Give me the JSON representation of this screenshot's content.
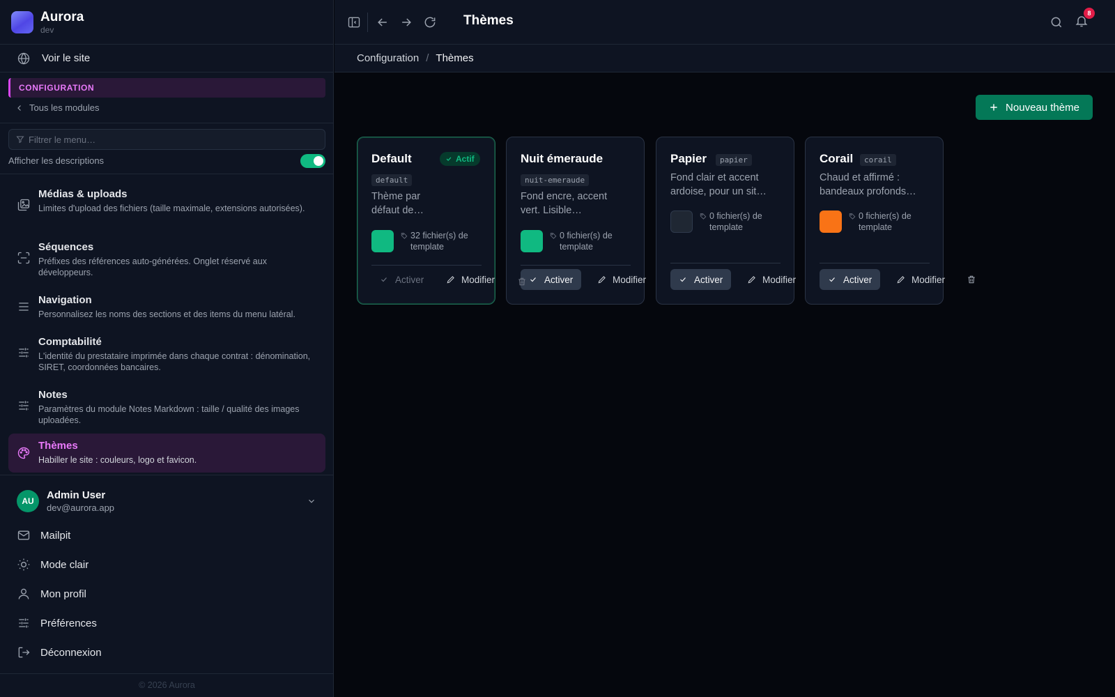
{
  "app": {
    "name": "Aurora",
    "env": "dev"
  },
  "sidebar": {
    "view_site": "Voir le site",
    "section_label": "CONFIGURATION",
    "back_link": "Tous les modules",
    "filter_placeholder": "Filtrer le menu…",
    "toggle_label": "Afficher les descriptions",
    "toggle_on": true,
    "items": [
      {
        "title": "Médias & uploads",
        "desc": "Limites d'upload des fichiers (taille maximale, extensions autorisées).",
        "icon": "image-upload-icon"
      },
      {
        "title": "Séquences",
        "desc": "Préfixes des références auto-générées. Onglet réservé aux développeurs.",
        "icon": "scan-icon"
      },
      {
        "title": "Navigation",
        "desc": "Personnalisez les noms des sections et des items du menu latéral.",
        "icon": "menu-lines-icon"
      },
      {
        "title": "Comptabilité",
        "desc": "L'identité du prestataire imprimée dans chaque contrat : dénomination, SIRET, coordonnées bancaires.",
        "icon": "sliders-icon"
      },
      {
        "title": "Notes",
        "desc": "Paramètres du module Notes Markdown : taille / qualité des images uploadées.",
        "icon": "sliders-icon"
      },
      {
        "title": "Thèmes",
        "desc": "Habiller le site : couleurs, logo et favicon.",
        "icon": "palette-icon",
        "active": true
      }
    ],
    "user": {
      "initials": "AU",
      "name": "Admin User",
      "email": "dev@aurora.app"
    },
    "bottom_items": [
      {
        "label": "Mailpit",
        "icon": "mail-icon"
      },
      {
        "label": "Mode clair",
        "icon": "sun-icon"
      },
      {
        "label": "Mon profil",
        "icon": "user-icon"
      },
      {
        "label": "Préférences",
        "icon": "sliders-icon"
      },
      {
        "label": "Déconnexion",
        "icon": "logout-icon"
      }
    ],
    "footer": "© 2026 Aurora"
  },
  "topbar": {
    "title": "Thèmes",
    "notification_count": "8"
  },
  "breadcrumb": {
    "parent": "Configuration",
    "separator": "/",
    "current": "Thèmes"
  },
  "main": {
    "new_theme_label": "Nouveau thème",
    "activate_label": "Activer",
    "edit_label": "Modifier",
    "active_badge": "Actif",
    "themes": [
      {
        "name": "Default",
        "slug": "default",
        "desc_line1": "Thème par",
        "desc_line2": "défaut de…",
        "color": "#10b981",
        "files_line1": "32 fichier(s) de",
        "files_line2": "template",
        "active": true
      },
      {
        "name": "Nuit émeraude",
        "slug": "nuit-emeraude",
        "desc_line1": "Fond encre, accent",
        "desc_line2": "vert. Lisible…",
        "color": "#10b981",
        "files_line1": "0 fichier(s) de",
        "files_line2": "template",
        "active": false
      },
      {
        "name": "Papier",
        "slug": "papier",
        "desc_line1": "Fond clair et accent",
        "desc_line2": "ardoise, pour un sit…",
        "color": "#1f2733",
        "files_line1": "0 fichier(s) de",
        "files_line2": "template",
        "active": false
      },
      {
        "name": "Corail",
        "slug": "corail",
        "desc_line1": "Chaud et affirmé :",
        "desc_line2": "bandeaux profonds…",
        "color": "#f97316",
        "files_line1": "0 fichier(s) de",
        "files_line2": "template",
        "active": false
      }
    ]
  },
  "colors": {
    "accent": "#d946ef",
    "primary": "#047857",
    "success": "#10b981",
    "badge": "#e11d48"
  }
}
